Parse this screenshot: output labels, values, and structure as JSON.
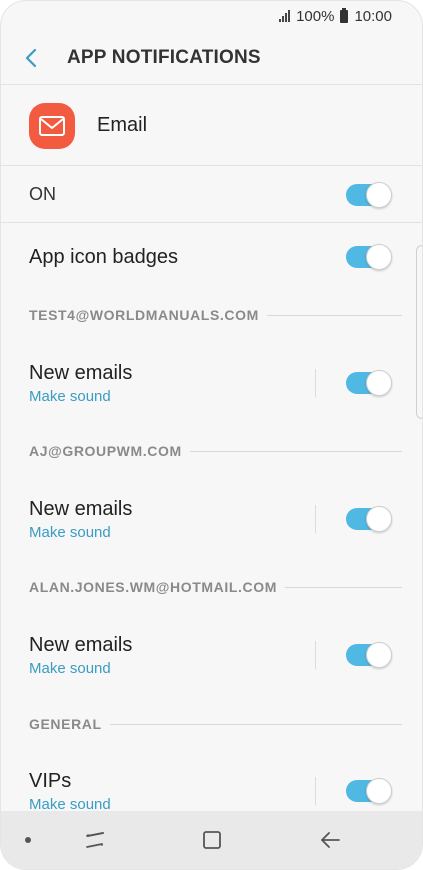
{
  "status_bar": {
    "battery_percent": "100%",
    "time": "10:00"
  },
  "app_bar": {
    "title": "APP NOTIFICATIONS"
  },
  "app": {
    "name": "Email",
    "icon_color": "#f25b3f"
  },
  "master": {
    "label": "ON",
    "enabled": true
  },
  "badges": {
    "label": "App icon badges",
    "enabled": true
  },
  "accounts": [
    {
      "header": "TEST4@WORLDMANUALS.COM",
      "title": "New emails",
      "subtitle": "Make sound",
      "enabled": true
    },
    {
      "header": "AJ@GROUPWM.COM",
      "title": "New emails",
      "subtitle": "Make sound",
      "enabled": true
    },
    {
      "header": "ALAN.JONES.WM@HOTMAIL.COM",
      "title": "New emails",
      "subtitle": "Make sound",
      "enabled": true
    }
  ],
  "general": {
    "header": "GENERAL",
    "title": "VIPs",
    "subtitle": "Make sound",
    "enabled": true
  },
  "colors": {
    "accent": "#4fb8e3",
    "subtitle": "#3a9cc2",
    "section": "#8a8a8a"
  }
}
